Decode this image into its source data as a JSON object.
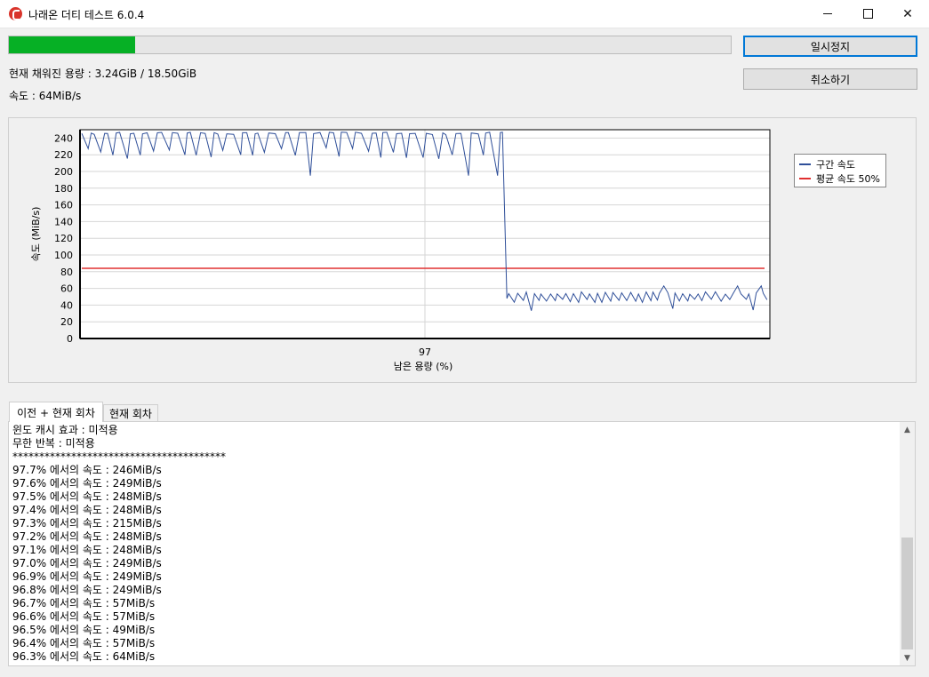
{
  "window": {
    "title": "나래온 더티 테스트 6.0.4",
    "minimize_glyph": "—",
    "close_glyph": "✕"
  },
  "progress": {
    "fraction": 0.175,
    "fill_color": "#06b025"
  },
  "buttons": {
    "pause": "일시정지",
    "cancel": "취소하기"
  },
  "status": {
    "filled": "현재 채워진 용량 : 3.24GiB / 18.50GiB",
    "speed": "속도 : 64MiB/s"
  },
  "chart_data": {
    "type": "line",
    "xlabel": "남은 용량 (%)",
    "ylabel": "속도 (MiB/s)",
    "ylim": [
      0,
      250
    ],
    "y_ticks": [
      "0",
      "20",
      "40",
      "60",
      "80",
      "100",
      "120",
      "140",
      "160",
      "180",
      "200",
      "220",
      "240"
    ],
    "x_ticks": [
      "97"
    ],
    "x_tick_position": 0.5,
    "grid": true,
    "legend_position": "right",
    "series": [
      {
        "name": "구간 속도",
        "color": "#2f4f99",
        "phase1_level": 247,
        "phase1_fraction": 0.615,
        "phase2_level": 53
      },
      {
        "name": "평균 속도 50%",
        "color": "#e03030",
        "level": 84
      }
    ]
  },
  "tabs": {
    "prev": "이전 + 현재 회차",
    "current": "현재 회차"
  },
  "log": [
    "윈도 캐시 효과 : 미적용",
    "무한 반복 : 미적용",
    "****************************************",
    "97.7% 에서의 속도 : 246MiB/s",
    "97.6% 에서의 속도 : 249MiB/s",
    "97.5% 에서의 속도 : 248MiB/s",
    "97.4% 에서의 속도 : 248MiB/s",
    "97.3% 에서의 속도 : 215MiB/s",
    "97.2% 에서의 속도 : 248MiB/s",
    "97.1% 에서의 속도 : 248MiB/s",
    "97.0% 에서의 속도 : 249MiB/s",
    "96.9% 에서의 속도 : 249MiB/s",
    "96.8% 에서의 속도 : 249MiB/s",
    "96.7% 에서의 속도 : 57MiB/s",
    "96.6% 에서의 속도 : 57MiB/s",
    "96.5% 에서의 속도 : 49MiB/s",
    "96.4% 에서의 속도 : 57MiB/s",
    "96.3% 에서의 속도 : 64MiB/s"
  ]
}
